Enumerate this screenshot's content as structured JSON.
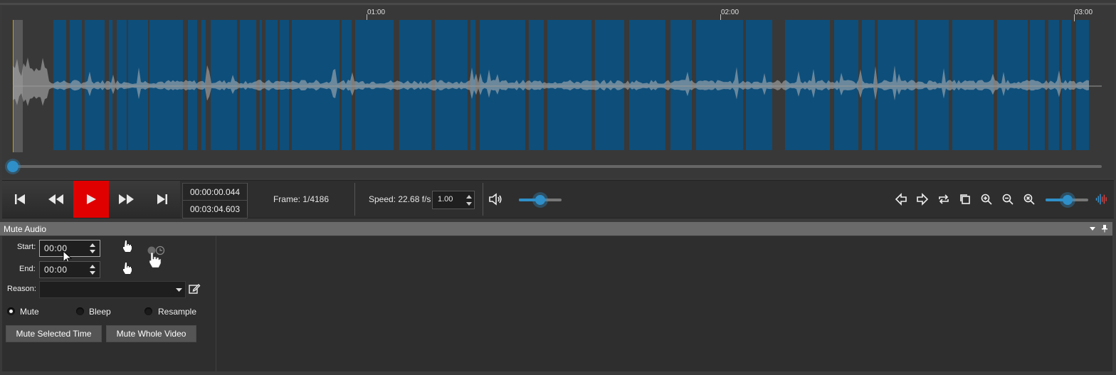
{
  "ruler": {
    "ticks": [
      {
        "label": "01:00"
      },
      {
        "label": "02:00"
      },
      {
        "label": "03:00"
      }
    ]
  },
  "colors": {
    "accent": "#2f8fc8",
    "play": "#e00000",
    "muted_region": "#0e4e7a",
    "waveform": "#b8b8b8"
  },
  "transport": {
    "buttons": [
      {
        "name": "skip-to-start",
        "icon": "skip-start-icon"
      },
      {
        "name": "rewind",
        "icon": "rewind-icon"
      },
      {
        "name": "play",
        "icon": "play-icon"
      },
      {
        "name": "fast-forward",
        "icon": "fast-forward-icon"
      },
      {
        "name": "skip-to-end",
        "icon": "skip-end-icon"
      }
    ],
    "current_time": "00:00:00.044",
    "total_time": "00:03:04.603",
    "frame": "Frame: 1/4186",
    "speed_label": "Speed: 22.68 f/s",
    "speed_value": "1.00",
    "right_icons": [
      "arrow-left-icon",
      "arrow-right-icon",
      "repeat-icon",
      "copy-icon",
      "zoom-in-icon",
      "zoom-out-icon",
      "zoom-reset-icon",
      "waveform-icon"
    ]
  },
  "mute_audio": {
    "title": "Mute Audio",
    "start_label": "Start:",
    "start_value": "00:00",
    "end_label": "End:",
    "end_value": "00:00",
    "reason_label": "Reason:",
    "reason_value": "",
    "modes": [
      {
        "label": "Mute",
        "selected": true
      },
      {
        "label": "Bleep",
        "selected": false
      },
      {
        "label": "Resample",
        "selected": false
      }
    ],
    "mute_selected_label": "Mute Selected Time",
    "mute_whole_label": "Mute Whole Video"
  }
}
